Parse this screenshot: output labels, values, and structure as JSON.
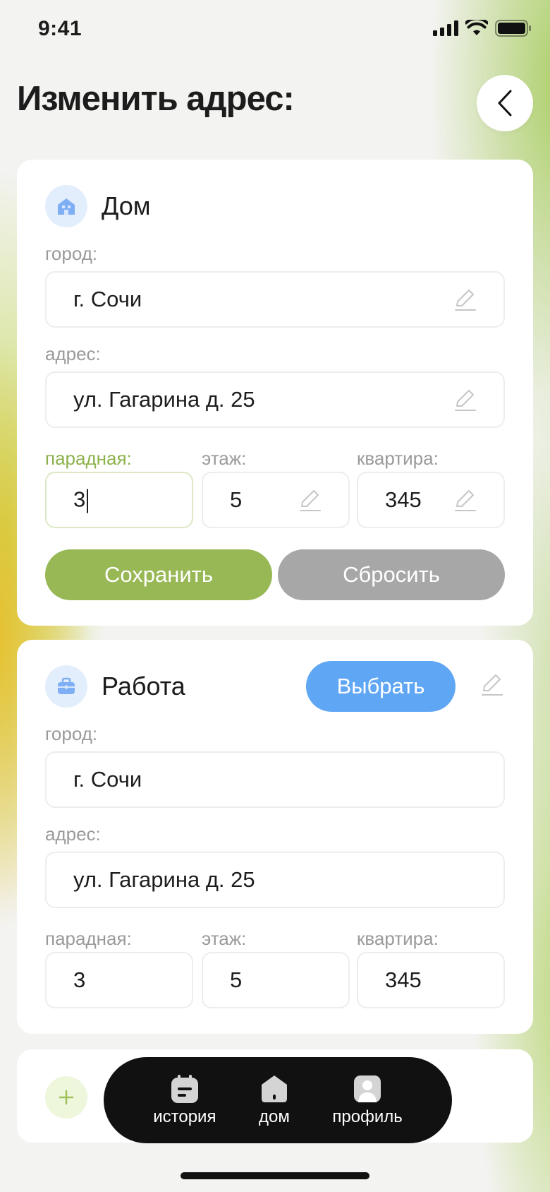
{
  "status_bar": {
    "time": "9:41"
  },
  "header": {
    "title": "Изменить адрес:"
  },
  "home_card": {
    "name": "Дом",
    "city_label": "город:",
    "city_value": "г. Сочи",
    "address_label": "адрес:",
    "address_value": "ул. Гагарина д. 25",
    "entrance_label": "парадная:",
    "entrance_value": "3",
    "floor_label": "этаж:",
    "floor_value": "5",
    "apartment_label": "квартира:",
    "apartment_value": "345",
    "save_label": "Сохранить",
    "reset_label": "Сбросить"
  },
  "work_card": {
    "name": "Работа",
    "select_label": "Выбрать",
    "city_label": "город:",
    "city_value": "г. Сочи",
    "address_label": "адрес:",
    "address_value": "ул. Гагарина д. 25",
    "entrance_label": "парадная:",
    "entrance_value": "3",
    "floor_label": "этаж:",
    "floor_value": "5",
    "apartment_label": "квартира:",
    "apartment_value": "345"
  },
  "add_card": {
    "icon": "plus"
  },
  "tab_bar": {
    "items": [
      {
        "label": "история",
        "icon": "calendar-note-icon"
      },
      {
        "label": "дом",
        "icon": "house-icon"
      },
      {
        "label": "профиль",
        "icon": "profile-icon"
      }
    ]
  },
  "colors": {
    "accent_green": "#97b854",
    "accent_blue": "#5fa6f4",
    "reset_gray": "#a7a7a7",
    "active_label": "#8cb14b"
  }
}
